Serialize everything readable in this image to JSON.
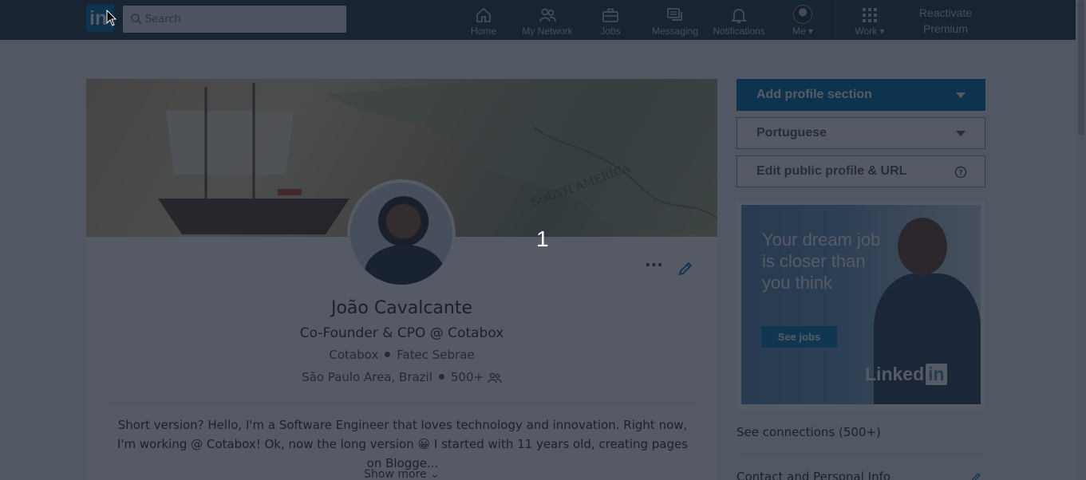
{
  "nav": {
    "logo": "in",
    "search_placeholder": "Search",
    "items": [
      {
        "label": "Home",
        "icon": "home-icon"
      },
      {
        "label": "My Network",
        "icon": "network-icon"
      },
      {
        "label": "Jobs",
        "icon": "briefcase-icon"
      },
      {
        "label": "Messaging",
        "icon": "messaging-icon"
      },
      {
        "label": "Notifications",
        "icon": "bell-icon"
      },
      {
        "label": "Me",
        "icon": "avatar"
      },
      {
        "label": "Work",
        "icon": "grid-icon"
      }
    ],
    "premium": "Reactivate Premium"
  },
  "profile": {
    "name": "João Cavalcante",
    "headline": "Co-Founder & CPO @ Cotabox",
    "company": "Cotabox",
    "school": "Fatec Sebrae",
    "location": "São Paulo Area, Brazil",
    "connections": "500+",
    "summary": "Short version? Hello, I'm a Software Engineer that loves technology and innovation. Right now, I'm working @ Cotabox! Ok, now the long version 😀 I started with 11 years old, creating pages on Blogge...",
    "show_more": "Show more",
    "overlay_step": "1"
  },
  "sidebar": {
    "add_section": "Add profile section",
    "language": "Portuguese",
    "public_profile": "Edit public profile & URL",
    "ad": {
      "headline": "Your dream job is closer than you think",
      "cta": "See jobs",
      "brand": "Linked",
      "brand_in": "in"
    },
    "see_connections": "See connections (500+)",
    "contact_info": "Contact and Personal Info"
  },
  "colors": {
    "nav_bg": "#283e4a",
    "accent": "#0073b1",
    "overlay": "rgba(20,27,42,0.72)"
  }
}
